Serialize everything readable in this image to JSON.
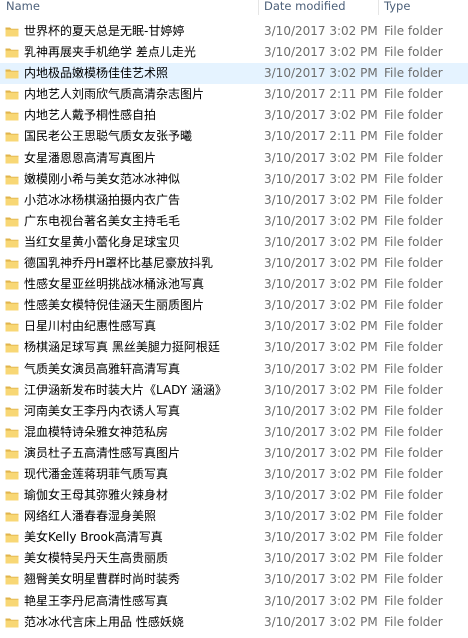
{
  "columns": {
    "name": "Name",
    "date": "Date modified",
    "type": "Type"
  },
  "items": [
    {
      "name": "世界杯的夏天总是无眠-甘婷婷",
      "date": "3/10/2017 3:02 PM",
      "type": "File folder"
    },
    {
      "name": "乳神再展夹手机绝学 差点儿走光",
      "date": "3/10/2017 3:02 PM",
      "type": "File folder"
    },
    {
      "name": "内地极品嫩模杨佳佳艺术照",
      "date": "3/10/2017 3:02 PM",
      "type": "File folder"
    },
    {
      "name": "内地艺人刘雨欣气质高清杂志图片",
      "date": "3/10/2017 2:11 PM",
      "type": "File folder"
    },
    {
      "name": "内地艺人戴予桐性感自拍",
      "date": "3/10/2017 3:02 PM",
      "type": "File folder"
    },
    {
      "name": "国民老公王思聪气质女友张予曦",
      "date": "3/10/2017 2:11 PM",
      "type": "File folder"
    },
    {
      "name": "女星潘恩恩高清写真图片",
      "date": "3/10/2017 3:02 PM",
      "type": "File folder"
    },
    {
      "name": "嫩模刚小希与美女范冰冰神似",
      "date": "3/10/2017 3:02 PM",
      "type": "File folder"
    },
    {
      "name": "小范冰冰杨棋涵拍摄内衣广告",
      "date": "3/10/2017 3:02 PM",
      "type": "File folder"
    },
    {
      "name": "广东电视台著名美女主持毛毛",
      "date": "3/10/2017 3:02 PM",
      "type": "File folder"
    },
    {
      "name": "当红女星黄小蕾化身足球宝贝",
      "date": "3/10/2017 3:02 PM",
      "type": "File folder"
    },
    {
      "name": "德国乳神乔丹H罩杯比基尼豪放抖乳",
      "date": "3/10/2017 3:02 PM",
      "type": "File folder"
    },
    {
      "name": "性感女星亚丝明挑战冰桶泳池写真",
      "date": "3/10/2017 3:02 PM",
      "type": "File folder"
    },
    {
      "name": "性感美女模特倪佳涵天生丽质图片",
      "date": "3/10/2017 3:02 PM",
      "type": "File folder"
    },
    {
      "name": "日星川村由纪惠性感写真",
      "date": "3/10/2017 3:02 PM",
      "type": "File folder"
    },
    {
      "name": "杨棋涵足球写真 黑丝美腿力挺阿根廷",
      "date": "3/10/2017 3:02 PM",
      "type": "File folder"
    },
    {
      "name": "气质美女演员高雅轩高清写真",
      "date": "3/10/2017 3:02 PM",
      "type": "File folder"
    },
    {
      "name": "江伊涵新发布时装大片《LADY 涵涵》",
      "date": "3/10/2017 3:02 PM",
      "type": "File folder"
    },
    {
      "name": "河南美女王李丹内衣诱人写真",
      "date": "3/10/2017 3:02 PM",
      "type": "File folder"
    },
    {
      "name": "混血模特诗朵雅女神范私房",
      "date": "3/10/2017 3:02 PM",
      "type": "File folder"
    },
    {
      "name": "演员杜子五高清性感写真图片",
      "date": "3/10/2017 3:02 PM",
      "type": "File folder"
    },
    {
      "name": "现代潘金莲蒋玥菲气质写真",
      "date": "3/10/2017 3:02 PM",
      "type": "File folder"
    },
    {
      "name": "瑜伽女王母其弥雅火辣身材",
      "date": "3/10/2017 3:02 PM",
      "type": "File folder"
    },
    {
      "name": "网络红人潘春春湿身美照",
      "date": "3/10/2017 3:02 PM",
      "type": "File folder"
    },
    {
      "name": "美女Kelly Brook高清写真",
      "date": "3/10/2017 3:02 PM",
      "type": "File folder"
    },
    {
      "name": "美女模特吴丹天生高贵丽质",
      "date": "3/10/2017 3:02 PM",
      "type": "File folder"
    },
    {
      "name": "翘臀美女明星曹群时尚时装秀",
      "date": "3/10/2017 3:02 PM",
      "type": "File folder"
    },
    {
      "name": "艳星王李丹尼高清性感写真",
      "date": "3/10/2017 3:02 PM",
      "type": "File folder"
    },
    {
      "name": "范冰冰代言床上用品 性感妖娆",
      "date": "3/10/2017 3:02 PM",
      "type": "File folder"
    }
  ],
  "selected_index": 2,
  "colors": {
    "folder": "#f8d775",
    "folder_dark": "#e0b44c",
    "selection": "#e5f3ff",
    "header_text": "#4c607a"
  }
}
